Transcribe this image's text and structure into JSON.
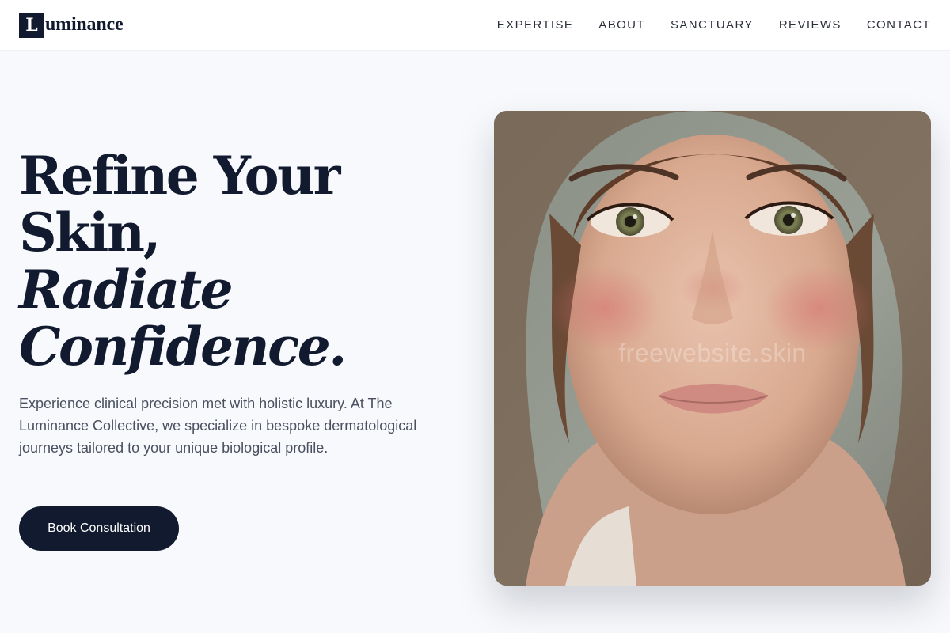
{
  "brand": {
    "mark": "L",
    "rest": "uminance"
  },
  "nav": {
    "items": [
      {
        "label": "EXPERTISE"
      },
      {
        "label": "ABOUT"
      },
      {
        "label": "SANCTUARY"
      },
      {
        "label": "REVIEWS"
      },
      {
        "label": "CONTACT"
      }
    ]
  },
  "hero": {
    "headline_line1": "Refine Your",
    "headline_line2": "Skin,",
    "headline_line3": "Radiate",
    "headline_line4": "Confidence.",
    "subtext": "Experience clinical precision met with holistic luxury. At The Luminance Collective, we specialize in bespoke dermatological journeys tailored to your unique biological profile.",
    "cta_label": "Book Consultation",
    "image_watermark": "freewebsite.skin"
  },
  "colors": {
    "primary": "#111a2e",
    "background": "#f8f9fc",
    "body_text": "#4a5060",
    "header_bg": "#ffffff"
  }
}
